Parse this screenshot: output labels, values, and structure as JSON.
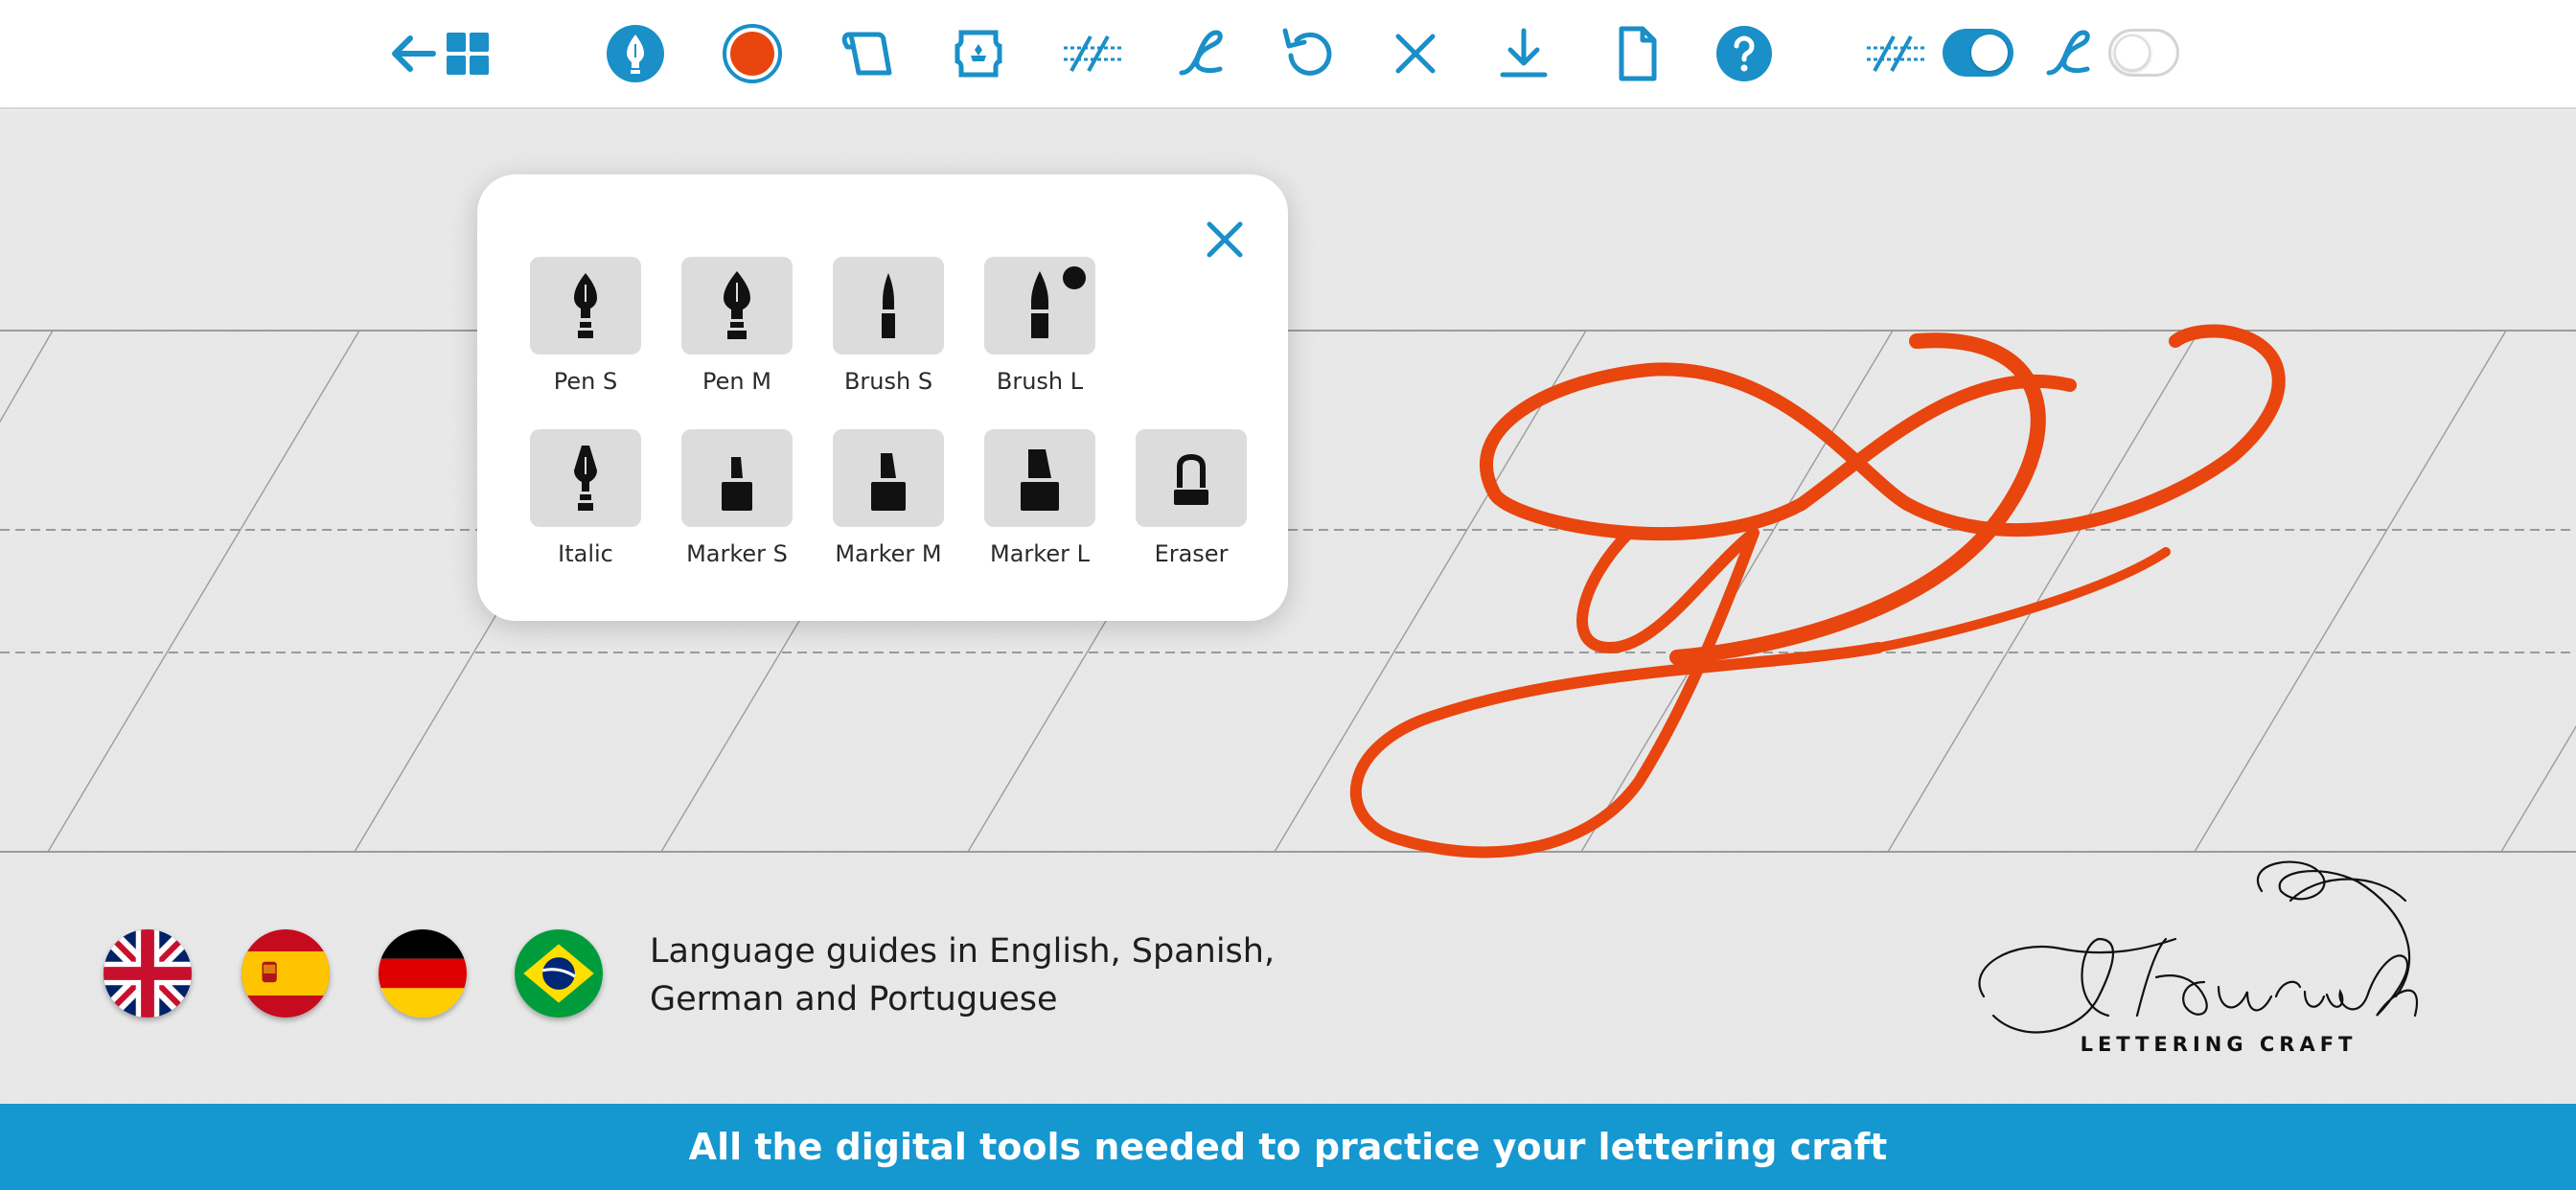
{
  "colors": {
    "accent": "#1a8fc8",
    "ink_orange": "#e8450f",
    "banner": "#1597cf"
  },
  "toolbar": {
    "items": [
      {
        "icon": "back-arrow-icon"
      },
      {
        "icon": "grid-icon"
      },
      {
        "icon": "pen-tool-icon"
      },
      {
        "icon": "color-swatch-icon"
      },
      {
        "icon": "scroll-icon"
      },
      {
        "icon": "stamp-icon"
      },
      {
        "icon": "guidelines-icon"
      },
      {
        "icon": "letter-l-icon"
      },
      {
        "icon": "undo-icon"
      },
      {
        "icon": "clear-icon"
      },
      {
        "icon": "download-icon"
      },
      {
        "icon": "page-icon"
      },
      {
        "icon": "help-icon"
      }
    ],
    "toggles": [
      {
        "icon": "guidelines-icon",
        "state": "on"
      },
      {
        "icon": "letter-l-icon",
        "state": "off"
      }
    ]
  },
  "tool_popup": {
    "tools": [
      {
        "label": "Pen S",
        "icon": "pen-nib-icon"
      },
      {
        "label": "Pen M",
        "icon": "pen-nib-icon"
      },
      {
        "label": "Brush S",
        "icon": "brush-icon"
      },
      {
        "label": "Brush L",
        "icon": "brush-icon",
        "selected": true
      },
      {
        "label": "Italic",
        "icon": "italic-nib-icon"
      },
      {
        "label": "Marker S",
        "icon": "marker-icon"
      },
      {
        "label": "Marker M",
        "icon": "marker-icon"
      },
      {
        "label": "Marker L",
        "icon": "marker-icon"
      },
      {
        "label": "Eraser",
        "icon": "eraser-icon"
      }
    ]
  },
  "languages": {
    "flags": [
      "uk-flag-icon",
      "spain-flag-icon",
      "germany-flag-icon",
      "brazil-flag-icon"
    ],
    "line1": "Language guides in English, Spanish,",
    "line2": "German and Portuguese"
  },
  "logo": {
    "title": "Flourish",
    "subtitle": "LETTERING CRAFT"
  },
  "banner": {
    "text": "All the digital tools needed to practice your lettering craft"
  }
}
